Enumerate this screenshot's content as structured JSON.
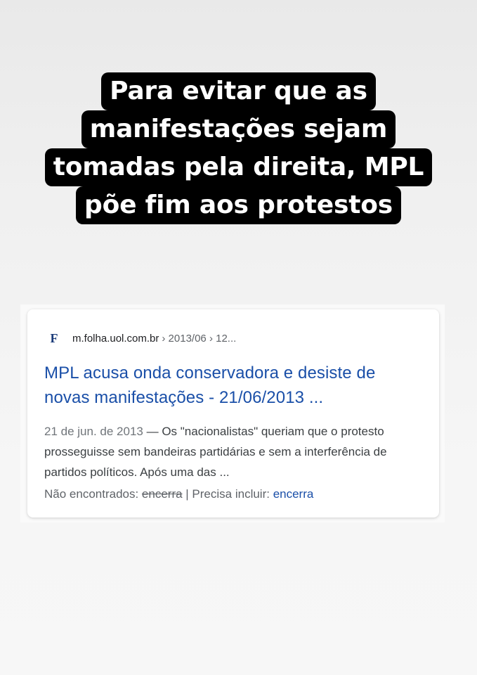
{
  "headline": {
    "lines": [
      "Para evitar que as",
      "manifestações sejam",
      "tomadas pela direita, MPL",
      "põe fim aos protestos"
    ]
  },
  "result": {
    "favicon_letter": "F",
    "domain": "m.folha.uol.com.br",
    "path": "› 2013/06 › 12...",
    "title": "MPL acusa onda conservadora e desiste de novas manifestações - 21/06/2013 ...",
    "snippet_date": "21 de jun. de 2013",
    "snippet_sep": " — ",
    "snippet_text": "Os \"nacionalistas\" queriam que o protesto prosseguisse sem bandeiras partidárias e sem a interferência de partidos políticos. Após uma das ...",
    "missing_label": "Não encontrados: ",
    "missing_term": "encerra",
    "must_include_label": " | Precisa incluir: ",
    "must_include_term": "encerra",
    "colors": {
      "title": "#1a4fa8",
      "favicon": "#1a3a78"
    }
  }
}
